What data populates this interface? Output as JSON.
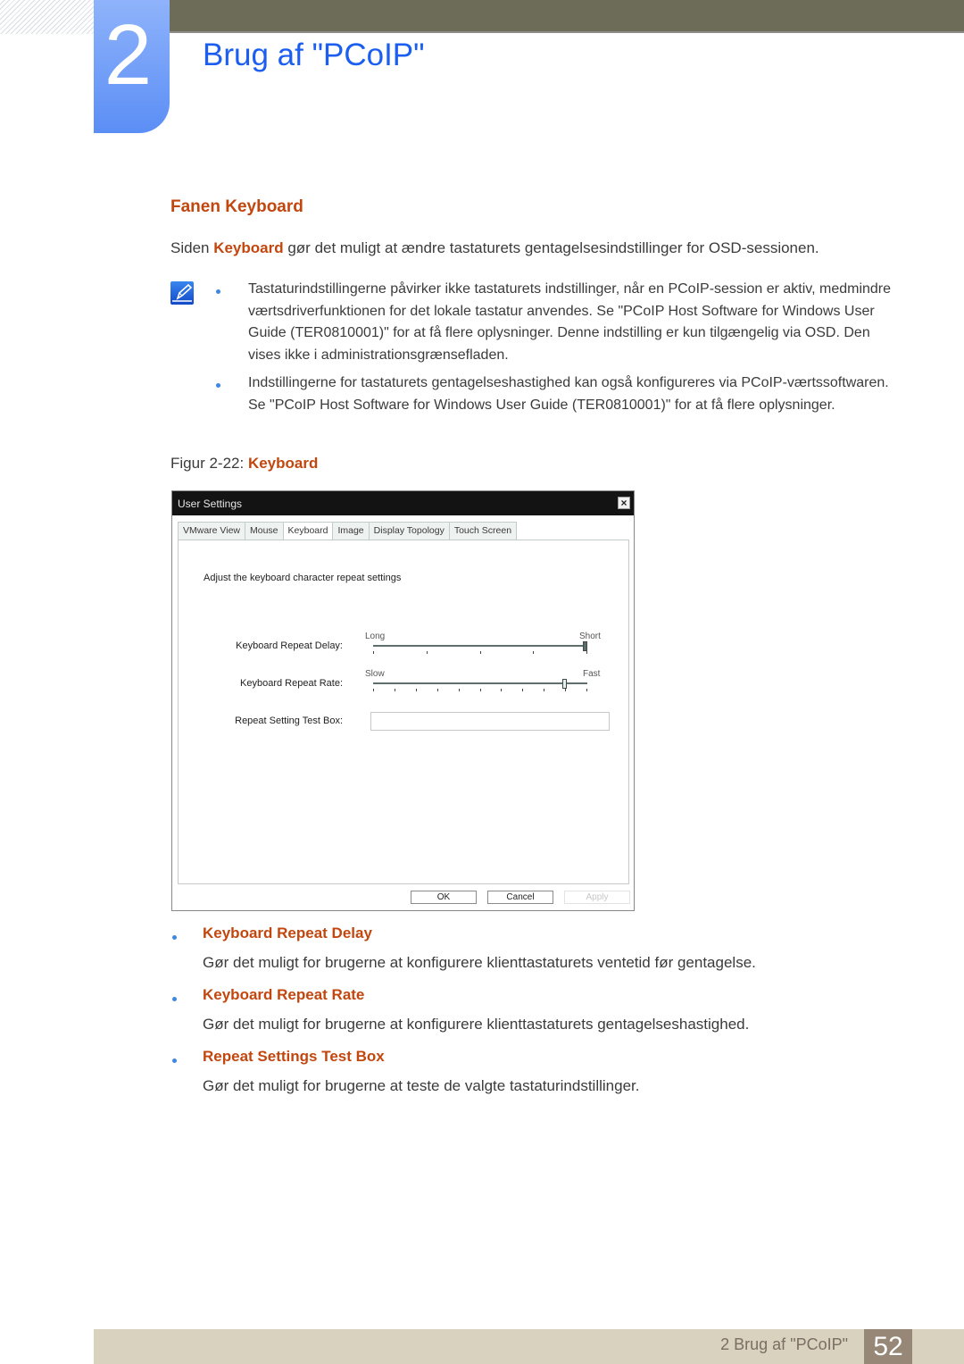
{
  "header": {
    "chapter_number": "2",
    "chapter_title": "Brug af \"PCoIP\"",
    "colors": {
      "top_bar": "#6d6c59",
      "chapter_tab": "#5b8ef5",
      "title": "#1b5ef0"
    }
  },
  "section": {
    "heading": "Fanen Keyboard",
    "intro_prefix": "Siden ",
    "intro_highlight": "Keyboard",
    "intro_suffix": " gør det muligt at ændre tastaturets gentagelsesindstillinger for OSD-sessionen.",
    "accent_color": "#c2470f"
  },
  "note": {
    "icon": "note-pencil-icon",
    "items": [
      "Tastaturindstillingerne påvirker ikke tastaturets indstillinger, når en PCoIP-session er aktiv, medmindre værtsdriverfunktionen for det lokale tastatur anvendes. Se \"PCoIP Host Software for Windows User Guide (TER0810001)\" for at få flere oplysninger. Denne indstilling er kun tilgængelig via OSD. Den vises ikke i administrationsgrænsefladen.",
      "Indstillingerne for tastaturets gentagelseshastighed kan også konfigureres via PCoIP-værtssoftwaren. Se \"PCoIP Host Software for Windows User Guide (TER0810001)\" for at få flere oplysninger."
    ]
  },
  "figure": {
    "caption_prefix": "Figur 2-22: ",
    "caption_highlight": "Keyboard"
  },
  "dialog": {
    "title": "User Settings",
    "close_icon": "close-icon",
    "tabs": [
      {
        "label": "VMware View",
        "active": false
      },
      {
        "label": "Mouse",
        "active": false
      },
      {
        "label": "Keyboard",
        "active": true
      },
      {
        "label": "Image",
        "active": false
      },
      {
        "label": "Display Topology",
        "active": false
      },
      {
        "label": "Touch Screen",
        "active": false
      }
    ],
    "heading": "Adjust the keyboard character repeat settings",
    "delay": {
      "label": "Keyboard Repeat Delay:",
      "min_label": "Long",
      "max_label": "Short",
      "ticks": 5,
      "value_fraction": 1.0
    },
    "rate": {
      "label": "Keyboard Repeat Rate:",
      "min_label": "Slow",
      "max_label": "Fast",
      "ticks": 11,
      "value_fraction": 0.9
    },
    "test_box": {
      "label": "Repeat Setting Test Box:",
      "value": ""
    },
    "buttons": {
      "ok": "OK",
      "cancel": "Cancel",
      "apply": "Apply"
    }
  },
  "descriptions": [
    {
      "title": "Keyboard Repeat Delay",
      "text": "Gør det muligt for brugerne at konfigurere klienttastaturets ventetid før gentagelse."
    },
    {
      "title": "Keyboard Repeat Rate",
      "text": "Gør det muligt for brugerne at konfigurere klienttastaturets gentagelseshastighed."
    },
    {
      "title": "Repeat Settings Test Box",
      "text": "Gør det muligt for brugerne at teste de valgte tastaturindstillinger."
    }
  ],
  "footer": {
    "chapter_label": "2 Brug af \"PCoIP\"",
    "page_number": "52"
  }
}
